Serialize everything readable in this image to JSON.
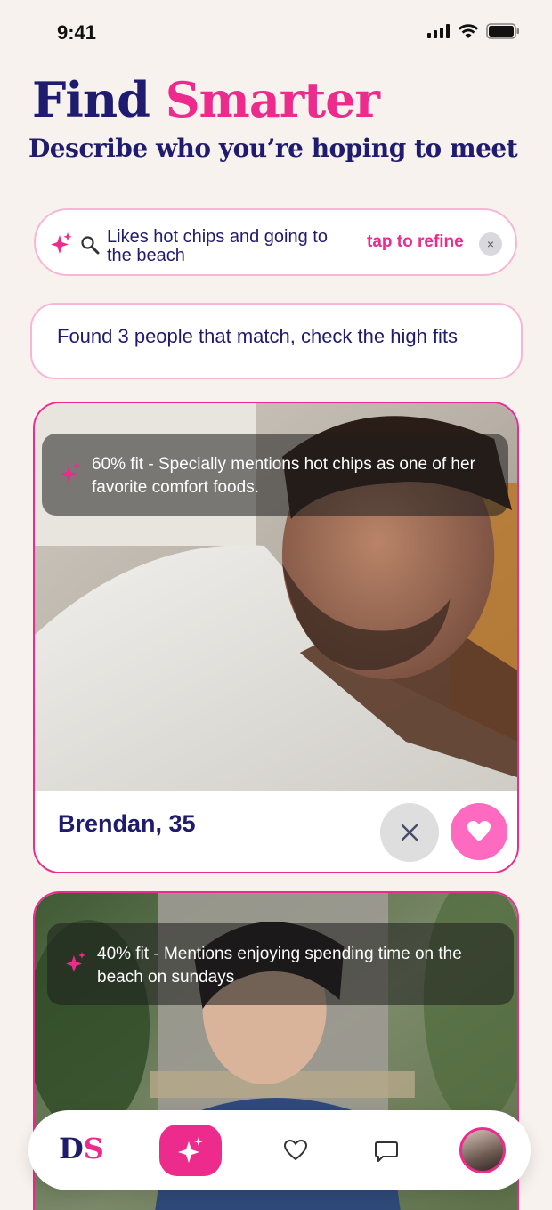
{
  "status": {
    "time": "9:41"
  },
  "header": {
    "title_part1": "Find",
    "title_part2": "Smarter",
    "subtitle": "Describe who you’re hoping to meet"
  },
  "search": {
    "query": "Likes hot chips and going to  the beach",
    "refine_label": "tap to refine",
    "clear_label": "×"
  },
  "results": {
    "message": "Found 3 people that match, check the high fits"
  },
  "cards": [
    {
      "fit_text": "60% fit - Specially mentions hot chips as one of her favorite comfort foods.",
      "name": "Brendan, 35"
    },
    {
      "fit_text": "40% fit - Mentions enjoying spending time on the beach on sundays"
    }
  ],
  "tabbar": {
    "logo_letter": "D",
    "logo_heart": "S"
  },
  "colors": {
    "brand_pink": "#ec2b8c",
    "navy": "#1f1b6e",
    "background": "#f7f2ee",
    "like_pink": "#ff6ac1"
  },
  "icons": [
    "sparkle-icon",
    "search-icon",
    "close-icon",
    "heart-icon",
    "chat-icon",
    "signal-icon",
    "wifi-icon",
    "battery-icon"
  ]
}
